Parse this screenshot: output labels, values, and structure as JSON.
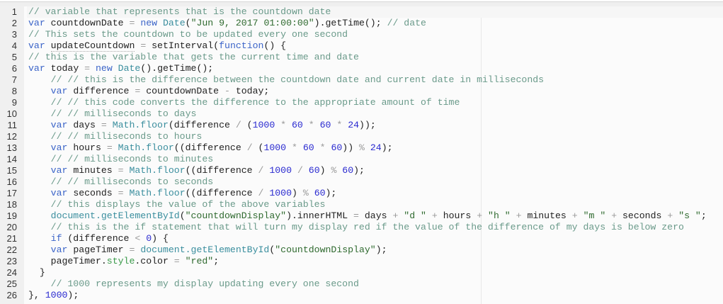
{
  "editor": {
    "active_line": 1,
    "lines": [
      {
        "n": "1",
        "t": [
          [
            "c",
            "// variable that represents that is the countdown date"
          ]
        ]
      },
      {
        "n": "2",
        "t": [
          [
            "k",
            "var"
          ],
          [
            "p",
            " countdownDate "
          ],
          [
            "o",
            "="
          ],
          [
            "p",
            " "
          ],
          [
            "k",
            "new"
          ],
          [
            "p",
            " "
          ],
          [
            "b",
            "Date"
          ],
          [
            "p",
            "("
          ],
          [
            "s",
            "\"Jun 9, 2017 01:00:00\""
          ],
          [
            "p",
            ").getTime(); "
          ],
          [
            "c",
            "// date"
          ]
        ]
      },
      {
        "n": "3",
        "t": [
          [
            "c",
            "// This sets the countdown to be updated every one second"
          ]
        ]
      },
      {
        "n": "4",
        "t": [
          [
            "k",
            "var"
          ],
          [
            "p",
            " "
          ],
          [
            "u",
            "updateCountdown"
          ],
          [
            "p",
            " "
          ],
          [
            "o",
            "="
          ],
          [
            "p",
            " setInterval("
          ],
          [
            "k",
            "function"
          ],
          [
            "p",
            "() {"
          ]
        ]
      },
      {
        "n": "5",
        "t": [
          [
            "c",
            "// this is the variable that gets the current time and date"
          ]
        ]
      },
      {
        "n": "6",
        "t": [
          [
            "k",
            "var"
          ],
          [
            "p",
            " today "
          ],
          [
            "o",
            "="
          ],
          [
            "p",
            " "
          ],
          [
            "k",
            "new"
          ],
          [
            "p",
            " "
          ],
          [
            "b",
            "Date"
          ],
          [
            "p",
            "().getTime();"
          ]
        ]
      },
      {
        "n": "7",
        "t": [
          [
            "p",
            "    "
          ],
          [
            "c",
            "// // this is the difference between the countdown date and current date in milliseconds"
          ]
        ]
      },
      {
        "n": "8",
        "t": [
          [
            "p",
            "    "
          ],
          [
            "k",
            "var"
          ],
          [
            "p",
            " difference "
          ],
          [
            "o",
            "="
          ],
          [
            "p",
            " countdownDate "
          ],
          [
            "o",
            "-"
          ],
          [
            "p",
            " today;"
          ]
        ]
      },
      {
        "n": "9",
        "t": [
          [
            "p",
            "    "
          ],
          [
            "c",
            "// // this code converts the difference to the appropriate amount of time"
          ]
        ]
      },
      {
        "n": "10",
        "t": [
          [
            "p",
            "    "
          ],
          [
            "c",
            "// // milliseconds to days"
          ]
        ]
      },
      {
        "n": "11",
        "t": [
          [
            "p",
            "    "
          ],
          [
            "k",
            "var"
          ],
          [
            "p",
            " days "
          ],
          [
            "o",
            "="
          ],
          [
            "p",
            " "
          ],
          [
            "b",
            "Math.floor"
          ],
          [
            "p",
            "(difference "
          ],
          [
            "o",
            "/"
          ],
          [
            "p",
            " ("
          ],
          [
            "n",
            "1000"
          ],
          [
            "p",
            " "
          ],
          [
            "o",
            "*"
          ],
          [
            "p",
            " "
          ],
          [
            "n",
            "60"
          ],
          [
            "p",
            " "
          ],
          [
            "o",
            "*"
          ],
          [
            "p",
            " "
          ],
          [
            "n",
            "60"
          ],
          [
            "p",
            " "
          ],
          [
            "o",
            "*"
          ],
          [
            "p",
            " "
          ],
          [
            "n",
            "24"
          ],
          [
            "p",
            "));"
          ]
        ]
      },
      {
        "n": "12",
        "t": [
          [
            "p",
            "    "
          ],
          [
            "c",
            "// // milliseconds to hours"
          ]
        ]
      },
      {
        "n": "13",
        "t": [
          [
            "p",
            "    "
          ],
          [
            "k",
            "var"
          ],
          [
            "p",
            " hours "
          ],
          [
            "o",
            "="
          ],
          [
            "p",
            " "
          ],
          [
            "b",
            "Math.floor"
          ],
          [
            "p",
            "((difference "
          ],
          [
            "o",
            "/"
          ],
          [
            "p",
            " ("
          ],
          [
            "n",
            "1000"
          ],
          [
            "p",
            " "
          ],
          [
            "o",
            "*"
          ],
          [
            "p",
            " "
          ],
          [
            "n",
            "60"
          ],
          [
            "p",
            " "
          ],
          [
            "o",
            "*"
          ],
          [
            "p",
            " "
          ],
          [
            "n",
            "60"
          ],
          [
            "p",
            ")) "
          ],
          [
            "o",
            "%"
          ],
          [
            "p",
            " "
          ],
          [
            "n",
            "24"
          ],
          [
            "p",
            ");"
          ]
        ]
      },
      {
        "n": "14",
        "t": [
          [
            "p",
            "    "
          ],
          [
            "c",
            "// // milliseconds to minutes"
          ]
        ]
      },
      {
        "n": "15",
        "t": [
          [
            "p",
            "    "
          ],
          [
            "k",
            "var"
          ],
          [
            "p",
            " minutes "
          ],
          [
            "o",
            "="
          ],
          [
            "p",
            " "
          ],
          [
            "b",
            "Math.floor"
          ],
          [
            "p",
            "((difference "
          ],
          [
            "o",
            "/"
          ],
          [
            "p",
            " "
          ],
          [
            "n",
            "1000"
          ],
          [
            "p",
            " "
          ],
          [
            "o",
            "/"
          ],
          [
            "p",
            " "
          ],
          [
            "n",
            "60"
          ],
          [
            "p",
            ") "
          ],
          [
            "o",
            "%"
          ],
          [
            "p",
            " "
          ],
          [
            "n",
            "60"
          ],
          [
            "p",
            ");"
          ]
        ]
      },
      {
        "n": "16",
        "t": [
          [
            "p",
            "    "
          ],
          [
            "c",
            "// // milliseconds to seconds"
          ]
        ]
      },
      {
        "n": "17",
        "t": [
          [
            "p",
            "    "
          ],
          [
            "k",
            "var"
          ],
          [
            "p",
            " seconds "
          ],
          [
            "o",
            "="
          ],
          [
            "p",
            " "
          ],
          [
            "b",
            "Math.floor"
          ],
          [
            "p",
            "((difference "
          ],
          [
            "o",
            "/"
          ],
          [
            "p",
            " "
          ],
          [
            "n",
            "1000"
          ],
          [
            "p",
            ") "
          ],
          [
            "o",
            "%"
          ],
          [
            "p",
            " "
          ],
          [
            "n",
            "60"
          ],
          [
            "p",
            ");"
          ]
        ]
      },
      {
        "n": "18",
        "t": [
          [
            "p",
            "    "
          ],
          [
            "c",
            "// this displays the value of the above variables"
          ]
        ]
      },
      {
        "n": "19",
        "t": [
          [
            "p",
            "    "
          ],
          [
            "b",
            "document.getElementById"
          ],
          [
            "p",
            "("
          ],
          [
            "s",
            "\"countdownDisplay\""
          ],
          [
            "p",
            ").innerHTML "
          ],
          [
            "o",
            "="
          ],
          [
            "p",
            " days "
          ],
          [
            "o",
            "+"
          ],
          [
            "p",
            " "
          ],
          [
            "s",
            "\"d \""
          ],
          [
            "p",
            " "
          ],
          [
            "o",
            "+"
          ],
          [
            "p",
            " hours "
          ],
          [
            "o",
            "+"
          ],
          [
            "p",
            " "
          ],
          [
            "s",
            "\"h \""
          ],
          [
            "p",
            " "
          ],
          [
            "o",
            "+"
          ],
          [
            "p",
            " minutes "
          ],
          [
            "o",
            "+"
          ],
          [
            "p",
            " "
          ],
          [
            "s",
            "\"m \""
          ],
          [
            "p",
            " "
          ],
          [
            "o",
            "+"
          ],
          [
            "p",
            " seconds "
          ],
          [
            "o",
            "+"
          ],
          [
            "p",
            " "
          ],
          [
            "s",
            "\"s \""
          ],
          [
            "p",
            ";"
          ]
        ]
      },
      {
        "n": "20",
        "t": [
          [
            "p",
            "    "
          ],
          [
            "c",
            "// this is the if statement that will turn my display red if the value of the difference of my days is below zero"
          ]
        ]
      },
      {
        "n": "21",
        "t": [
          [
            "p",
            "    "
          ],
          [
            "k",
            "if"
          ],
          [
            "p",
            " (difference "
          ],
          [
            "o",
            "<"
          ],
          [
            "p",
            " "
          ],
          [
            "n",
            "0"
          ],
          [
            "p",
            ") {"
          ]
        ]
      },
      {
        "n": "22",
        "t": [
          [
            "p",
            "    "
          ],
          [
            "k",
            "var"
          ],
          [
            "p",
            " pageTimer "
          ],
          [
            "o",
            "="
          ],
          [
            "p",
            " "
          ],
          [
            "b",
            "document.getElementById"
          ],
          [
            "p",
            "("
          ],
          [
            "s",
            "\"countdownDisplay\""
          ],
          [
            "p",
            ");"
          ]
        ]
      },
      {
        "n": "23",
        "t": [
          [
            "p",
            "    pageTimer."
          ],
          [
            "g",
            "style"
          ],
          [
            "p",
            ".color "
          ],
          [
            "o",
            "="
          ],
          [
            "p",
            " "
          ],
          [
            "s",
            "\"red\""
          ],
          [
            "p",
            ";"
          ]
        ]
      },
      {
        "n": "24",
        "t": [
          [
            "p",
            "  }"
          ]
        ]
      },
      {
        "n": "25",
        "t": [
          [
            "p",
            "    "
          ],
          [
            "c",
            "// 1000 represents my display updating every one second"
          ]
        ]
      },
      {
        "n": "26",
        "t": [
          [
            "p",
            "}, "
          ],
          [
            "n",
            "1000"
          ],
          [
            "p",
            ");"
          ]
        ]
      }
    ]
  }
}
